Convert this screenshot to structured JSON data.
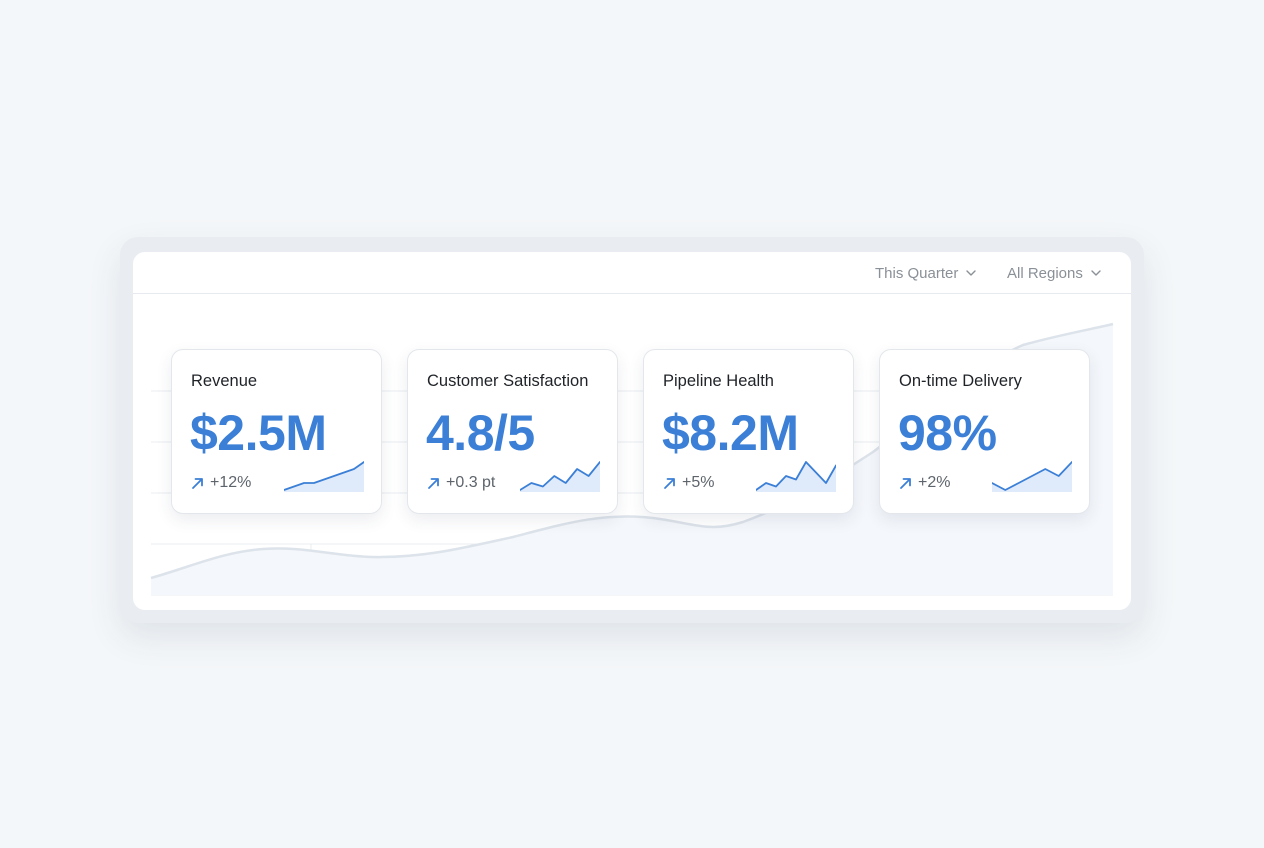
{
  "filters": [
    {
      "label": "This Quarter",
      "icon": "chevron-down-icon"
    },
    {
      "label": "All Regions",
      "icon": "chevron-down-icon"
    }
  ],
  "colors": {
    "accent": "#3b7fd6",
    "spark_fill": "#dfeafb",
    "background": "#f4f7f9"
  },
  "kpis": [
    {
      "title": "Revenue",
      "value": "$2.5M",
      "delta": "+12%",
      "trend_icon": "trend-up-arrow-icon",
      "sparkline": [
        2,
        3,
        4,
        4,
        5,
        6,
        7,
        8,
        10
      ]
    },
    {
      "title": "Customer Satisfaction",
      "value": "4.8/5",
      "delta": "+0.3 pt",
      "trend_icon": "trend-up-arrow-icon",
      "sparkline": [
        2,
        4,
        3,
        6,
        4,
        8,
        6,
        10
      ]
    },
    {
      "title": "Pipeline Health",
      "value": "$8.2M",
      "delta": "+5%",
      "trend_icon": "trend-up-arrow-icon",
      "sparkline": [
        1,
        3,
        2,
        5,
        4,
        9,
        6,
        3,
        8
      ]
    },
    {
      "title": "On-time Delivery",
      "value": "98%",
      "delta": "+2%",
      "trend_icon": "trend-up-arrow-icon",
      "sparkline": [
        6,
        5,
        6,
        7,
        8,
        7,
        9
      ]
    }
  ]
}
